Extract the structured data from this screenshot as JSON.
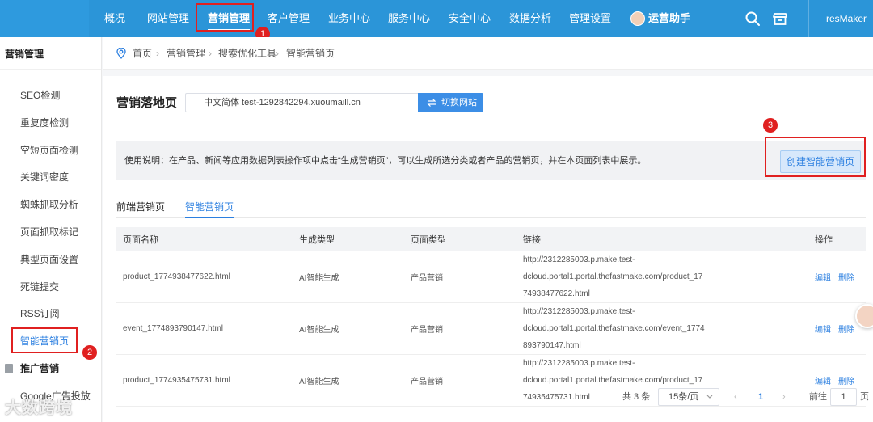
{
  "topnav": {
    "items": [
      "概况",
      "网站管理",
      "营销管理",
      "客户管理",
      "业务中心",
      "服务中心",
      "安全中心",
      "数据分析",
      "管理设置"
    ],
    "active": "营销管理",
    "assistant": "运营助手",
    "user": "resMaker"
  },
  "sidebar": {
    "header": "营销管理",
    "items": [
      "SEO检测",
      "重复度检测",
      "空短页面检测",
      "关键词密度",
      "蜘蛛抓取分析",
      "页面抓取标记",
      "典型页面设置",
      "死链提交",
      "RSS订阅",
      "智能营销页"
    ],
    "group": "推广营销",
    "group_items": [
      "Google广告投放"
    ]
  },
  "breadcrumb": [
    "首页",
    "营销管理",
    "搜索优化工具",
    "智能营销页"
  ],
  "page": {
    "title": "营销落地页",
    "site": "中文简体 test-1292842294.xuoumaill.cn",
    "switch_label": "切换网站",
    "notice": "使用说明：在产品、新闻等应用数据列表操作项中点击“生成营销页”，可以生成所选分类或者产品的营销页，并在本页面列表中展示。",
    "create_label": "创建智能营销页"
  },
  "tabs": [
    "前端营销页",
    "智能营销页"
  ],
  "active_tab": "智能营销页",
  "table": {
    "columns": [
      "页面名称",
      "生成类型",
      "页面类型",
      "链接",
      "操作"
    ],
    "rows": [
      {
        "name": "product_1774938477622.html",
        "gen": "AI智能生成",
        "type": "产品营销",
        "link1": "http://2312285003.p.make.test-dcloud.portal1.portal.thefastmake.com/product_17",
        "link2": "74938477622.html"
      },
      {
        "name": "event_1774893790147.html",
        "gen": "AI智能生成",
        "type": "产品营销",
        "link1": "http://2312285003.p.make.test-dcloud.portal1.portal.thefastmake.com/event_1774",
        "link2": "893790147.html"
      },
      {
        "name": "product_1774935475731.html",
        "gen": "AI智能生成",
        "type": "产品营销",
        "link1": "http://2312285003.p.make.test-dcloud.portal1.portal.thefastmake.com/product_17",
        "link2": "74935475731.html"
      }
    ],
    "edit_label": "编辑",
    "delete_label": "删除"
  },
  "pagination": {
    "total": "共 3 条",
    "page_size": "15条/页",
    "current": "1",
    "goto_prefix": "前往",
    "goto_value": "1",
    "goto_suffix": "页"
  },
  "annotations": [
    "1",
    "2",
    "3"
  ],
  "watermark": "大数跨境",
  "colors": {
    "topbar": "#2b95d8",
    "accent": "#2b7fe0",
    "highlight": "#e02020"
  }
}
